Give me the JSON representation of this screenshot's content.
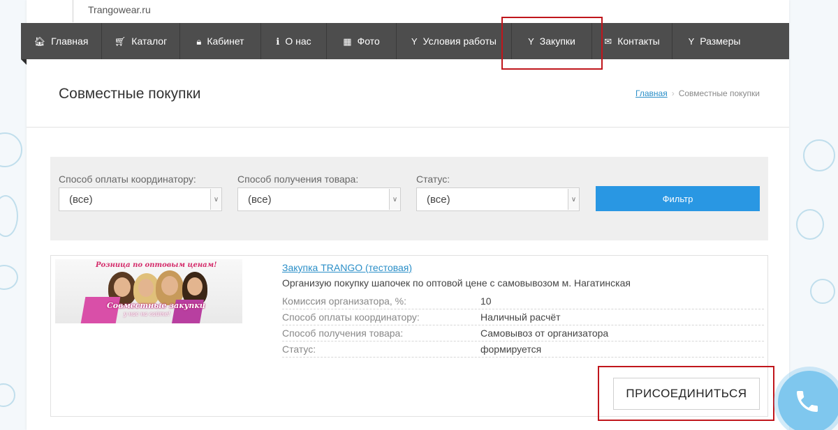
{
  "site": {
    "name": "Trangowear.ru"
  },
  "nav": {
    "items": [
      {
        "label": "Главная",
        "icon": "home-icon",
        "glyph": "🏠︎"
      },
      {
        "label": "Каталог",
        "icon": "cart-icon",
        "glyph": "🛒︎"
      },
      {
        "label": "Кабинет",
        "icon": "lock-icon",
        "glyph": "🔒︎"
      },
      {
        "label": "О нас",
        "icon": "info-icon",
        "glyph": "ℹ"
      },
      {
        "label": "Фото",
        "icon": "grid-icon",
        "glyph": "▦"
      },
      {
        "label": "Условия работы",
        "icon": "glass-icon",
        "glyph": "Y"
      },
      {
        "label": "Закупки",
        "icon": "glass-icon",
        "glyph": "Y"
      },
      {
        "label": "Контакты",
        "icon": "envelope-icon",
        "glyph": "✉"
      },
      {
        "label": "Размеры",
        "icon": "glass-icon",
        "glyph": "Y"
      }
    ]
  },
  "header": {
    "title": "Совместные покупки",
    "breadcrumb": {
      "home": "Главная",
      "separator": "›",
      "current": "Совместные покупки"
    }
  },
  "filters": {
    "payment": {
      "label": "Способ оплаты координатору:",
      "value": "(все)"
    },
    "delivery": {
      "label": "Способ получения товара:",
      "value": "(все)"
    },
    "status": {
      "label": "Статус:",
      "value": "(все)"
    },
    "button": "Фильтр"
  },
  "purchase": {
    "promo": {
      "top_text": "Розница по оптовым ценам!",
      "main_text": "Совместные закупки",
      "sub_text": "у нас на сайте!"
    },
    "title": "Закупка TRANGO (тестовая)",
    "description": "Организую покупку шапочек по оптовой цене с самовывозом м. Нагатинская",
    "props": [
      {
        "key": "Комиссия организатора, %:",
        "value": "10"
      },
      {
        "key": "Способ оплаты координатору:",
        "value": "Наличный расчёт"
      },
      {
        "key": "Способ получения товара:",
        "value": "Самовывоз от организатора"
      },
      {
        "key": "Статус:",
        "value": "формируется"
      }
    ],
    "join_button": "ПРИСОЕДИНИТЬСЯ"
  },
  "colors": {
    "nav_bg": "#4d4d4d",
    "accent": "#2997e3",
    "link": "#2b8fc8",
    "highlight": "#c0161c"
  }
}
